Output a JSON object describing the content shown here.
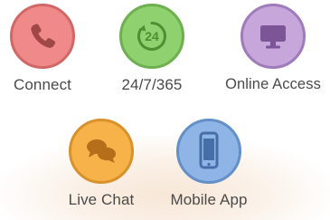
{
  "items": [
    {
      "label": "Connect",
      "icon": "phone-icon",
      "color": "#f08a8a",
      "icon_color": "#a24747"
    },
    {
      "label": "24/7/365",
      "icon": "clock-24-icon",
      "icon_text": "24",
      "color": "#8fd16f",
      "icon_color": "#4c8f34"
    },
    {
      "label": "Online Access",
      "icon": "monitor-icon",
      "color": "#c7a6dc",
      "icon_color": "#7b5596"
    },
    {
      "label": "Live Chat",
      "icon": "chat-bubbles-icon",
      "color": "#f7b24a",
      "icon_color": "#b56f1b"
    },
    {
      "label": "Mobile App",
      "icon": "smartphone-icon",
      "color": "#8fb4e6",
      "icon_color": "#456fa6"
    }
  ]
}
